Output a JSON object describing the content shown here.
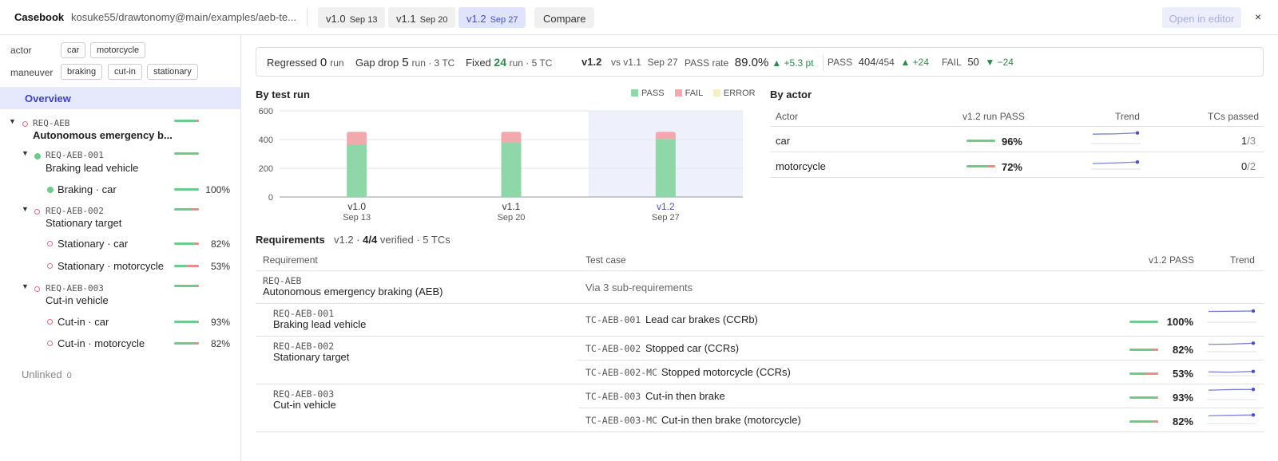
{
  "topbar": {
    "brand": "Casebook",
    "repo": "kosuke55/drawtonomy@main/examples/aeb-te...",
    "versions": [
      {
        "label": "v1.0",
        "date": "Sep 13",
        "active": false
      },
      {
        "label": "v1.1",
        "date": "Sep 20",
        "active": false
      },
      {
        "label": "v1.2",
        "date": "Sep 27",
        "active": true
      }
    ],
    "compare_label": "Compare",
    "open_editor_label": "Open in editor",
    "close_glyph": "×"
  },
  "sidebar": {
    "filters": {
      "actor_label": "actor",
      "actor_chips": [
        "car",
        "motorcycle"
      ],
      "maneuver_label": "maneuver",
      "maneuver_chips": [
        "braking",
        "cut-in",
        "stationary"
      ]
    },
    "overview_label": "Overview",
    "tree": {
      "root_id": "REQ-AEB",
      "root_name": "Autonomous emergency b...",
      "root_pass": 0.89,
      "children": [
        {
          "id": "REQ-AEB-001",
          "name": "Braking lead vehicle",
          "pass": 1.0,
          "tcs": [
            {
              "name": "Braking · car",
              "pct": "100%",
              "pass": 1.0
            }
          ]
        },
        {
          "id": "REQ-AEB-002",
          "name": "Stationary target",
          "pass": 0.68,
          "tcs": [
            {
              "name": "Stationary · car",
              "pct": "82%",
              "pass": 0.82
            },
            {
              "name": "Stationary · motorcycle",
              "pct": "53%",
              "pass": 0.53
            }
          ]
        },
        {
          "id": "REQ-AEB-003",
          "name": "Cut-in vehicle",
          "pass": 0.88,
          "tcs": [
            {
              "name": "Cut-in · car",
              "pct": "93%",
              "pass": 0.93
            },
            {
              "name": "Cut-in · motorcycle",
              "pct": "82%",
              "pass": 0.82
            }
          ]
        }
      ]
    },
    "unlinked_label": "Unlinked",
    "unlinked_count": "0",
    "expand_glyph": "▼"
  },
  "summary": {
    "regressed_label": "Regressed",
    "regressed_value": "0",
    "regressed_unit": "run",
    "gapdrop_label": "Gap drop",
    "gapdrop_value": "5",
    "gapdrop_unit": "run · 3 TC",
    "fixed_label": "Fixed",
    "fixed_value": "24",
    "fixed_unit": "run · 5 TC",
    "version": "v1.2",
    "vs_text": "vs v1.1",
    "vs_date": "Sep 27",
    "passrate_label": "PASS rate",
    "passrate_value": "89.0%",
    "passrate_delta": "▲ +5.3 pt",
    "pass_label": "PASS",
    "pass_value": "404",
    "pass_total": "/454",
    "pass_delta": "▲ +24",
    "fail_label": "FAIL",
    "fail_value": "50",
    "fail_delta": "▼ −24"
  },
  "by_test_run": {
    "title": "By test run",
    "legend": [
      {
        "label": "PASS",
        "color": "#8fd6a8"
      },
      {
        "label": "FAIL",
        "color": "#f2a9ad"
      },
      {
        "label": "ERROR",
        "color": "#f7efc4"
      }
    ]
  },
  "chart_data": {
    "type": "bar",
    "stacked": true,
    "categories": [
      "v1.0",
      "v1.1",
      "v1.2"
    ],
    "category_dates": [
      "Sep 13",
      "Sep 20",
      "Sep 27"
    ],
    "highlighted": "v1.2",
    "series": [
      {
        "name": "PASS",
        "values": [
          367,
          380,
          404
        ],
        "color": "#8fd6a8"
      },
      {
        "name": "FAIL",
        "values": [
          87,
          74,
          50
        ],
        "color": "#f2a9ad"
      },
      {
        "name": "ERROR",
        "values": [
          0,
          0,
          0
        ],
        "color": "#f7efc4"
      }
    ],
    "yticks": [
      "600",
      "400",
      "200",
      "0"
    ],
    "ylim": [
      0,
      600
    ],
    "grid": true
  },
  "by_actor": {
    "title": "By actor",
    "headers": {
      "actor": "Actor",
      "pass": "v1.2 run PASS",
      "trend": "Trend",
      "tcs": "TCs passed"
    },
    "rows": [
      {
        "actor": "car",
        "pct": "96%",
        "pass": 0.96,
        "tcs_passed": "1",
        "tcs_total": "/3",
        "trend": [
          0.88,
          0.9,
          0.96
        ]
      },
      {
        "actor": "motorcycle",
        "pct": "72%",
        "pass": 0.72,
        "tcs_passed": "0",
        "tcs_total": "/2",
        "trend": [
          0.62,
          0.66,
          0.72
        ]
      }
    ]
  },
  "requirements": {
    "title": "Requirements",
    "meta_version": "v1.2 ·",
    "meta_verified": "4/4",
    "meta_rest": "verified · 5 TCs",
    "headers": {
      "req": "Requirement",
      "tc": "Test case",
      "pass": "v1.2 PASS",
      "trend": "Trend"
    },
    "root": {
      "id": "REQ-AEB",
      "name": "Autonomous emergency braking (AEB)",
      "via": "Via 3 sub-requirements"
    },
    "groups": [
      {
        "id": "REQ-AEB-001",
        "name": "Braking lead vehicle",
        "tcs": [
          {
            "id": "TC-AEB-001",
            "name": "Lead car brakes (CCRb)",
            "pct": "100%",
            "pass": 1.0,
            "trend": [
              0.97,
              0.98,
              1.0
            ]
          }
        ]
      },
      {
        "id": "REQ-AEB-002",
        "name": "Stationary target",
        "tcs": [
          {
            "id": "TC-AEB-002",
            "name": "Stopped car (CCRs)",
            "pct": "82%",
            "pass": 0.82,
            "trend": [
              0.74,
              0.76,
              0.82
            ]
          },
          {
            "id": "TC-AEB-002-MC",
            "name": "Stopped motorcycle (CCRs)",
            "pct": "53%",
            "pass": 0.53,
            "trend": [
              0.5,
              0.48,
              0.53
            ]
          }
        ]
      },
      {
        "id": "REQ-AEB-003",
        "name": "Cut-in vehicle",
        "tcs": [
          {
            "id": "TC-AEB-003",
            "name": "Cut-in then brake",
            "pct": "93%",
            "pass": 0.93,
            "trend": [
              0.88,
              0.92,
              0.93
            ]
          },
          {
            "id": "TC-AEB-003-MC",
            "name": "Cut-in then brake (motorcycle)",
            "pct": "82%",
            "pass": 0.82,
            "trend": [
              0.77,
              0.8,
              0.82
            ]
          }
        ]
      }
    ]
  }
}
